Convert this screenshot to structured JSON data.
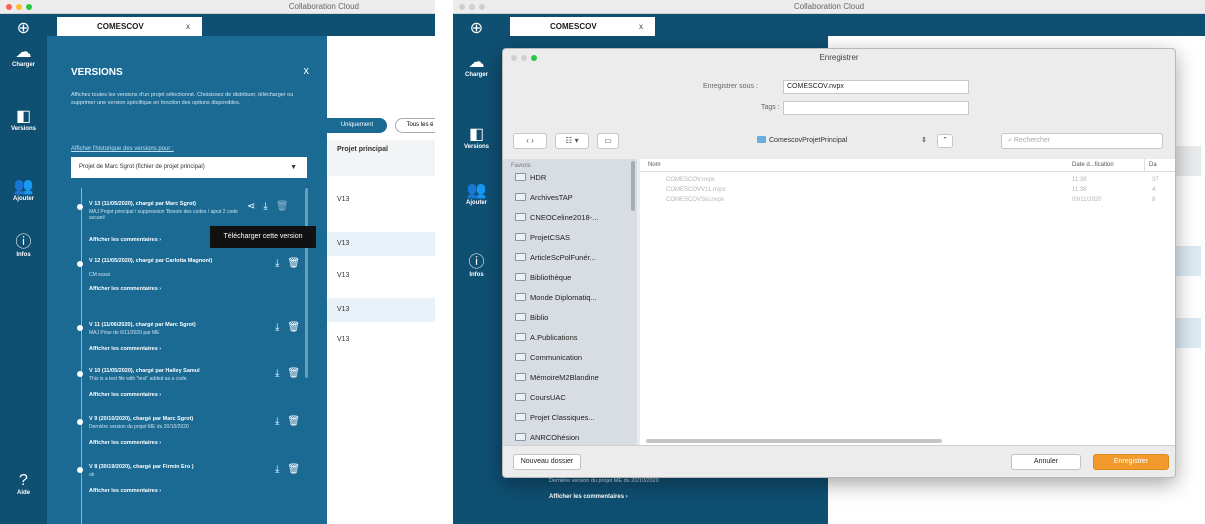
{
  "app": {
    "title": "Collaboration Cloud",
    "tab_label": "COMESCOV",
    "tab_close": "x"
  },
  "nav": {
    "charger": "Charger",
    "versions": "Versions",
    "ajouter": "Ajouter",
    "infos": "Infos",
    "aide": "Aide"
  },
  "versions_panel": {
    "title": "VERSIONS",
    "close": "x",
    "description": "Affichez toutes les versions d'un projet sélectionné. Choisissez de distribuer, télécharger ou supprimer une version spécifique en fonction des options disponibles.",
    "history_link": "Afficher l'historique des versions pour :",
    "select_value": "Projet de Marc Sgrot (fichier de projet principal)",
    "comments_label": "Afficher les commentaires",
    "items": [
      {
        "title": "V 13 (11/05/2020), chargé par Marc Sgrot)",
        "sub": "MAJ Projet principal / suppression 'Besoin des codes / ajout 2 code accueil"
      },
      {
        "title": "V 12 (11/05/2020), chargé par Carlotta Magnoni)",
        "sub": "CM essai"
      },
      {
        "title": "V 11 (11/06/2020), chargé par Marc Sgrot)",
        "sub": "MAJ Prise de 6/11/2020 par ME"
      },
      {
        "title": "V 10 (11/05/2020), chargé par Hailey Samul",
        "sub": "This is a test file with \"test\" added as a code"
      },
      {
        "title": "V 9 (20/10/2020), chargé par Marc Sgrot)",
        "sub": "Dernière version du projet ME du 20/10/2020"
      },
      {
        "title": "V 8 (30/19/2020), chargé par Firmin Ero )",
        "sub": "ok"
      }
    ],
    "tooltip": "Télécharger cette version"
  },
  "main_panel": {
    "filter_active": "Uniquement",
    "filter_all": "Tous les é",
    "column_header": "Projet principal",
    "rows": [
      "V13",
      "V13",
      "V13",
      "V13",
      "V13"
    ]
  },
  "save_dialog": {
    "title": "Enregistrer",
    "save_as_label": "Enregistrer sous :",
    "save_as_value": "COMESCOV.nvpx",
    "tags_label": "Tags :",
    "tags_value": "",
    "location": "ComescovProjetPrincipal",
    "search_placeholder": "Rechercher",
    "sidebar_header": "Favoris",
    "folders": [
      "HDR",
      "ArchivesTAP",
      "CNEOCeline2018-...",
      "ProjetCSAS",
      "ArticleScPolFunér...",
      "Bibliothèque",
      "Monde Diplomatiq...",
      "Biblio",
      "A.Publications",
      "Communication",
      "MémoireM2Blandine",
      "CoursUAC",
      "Projet Classiques...",
      "ANRCOhésion"
    ],
    "list_headers": {
      "name": "Nom",
      "date": "Date d...fication",
      "extra": "Da"
    },
    "files": [
      {
        "name": "COMESCOV.nvpx",
        "date": "11:38",
        "extra": "37"
      },
      {
        "name": "COMESCOVV11.nvpx",
        "date": "11:38",
        "extra": "4"
      },
      {
        "name": "COMESCOVSio.nvpx",
        "date": "09/11/2020",
        "extra": "8"
      }
    ],
    "new_folder": "Nouveau dossier",
    "cancel": "Annuler",
    "save": "Enregistrer"
  },
  "behind_dialog": {
    "desc": "Dernière version du projet ME du 20/10/2020",
    "comments": "Afficher les commentaires"
  },
  "colors": {
    "rail": "#0f4f72",
    "panel": "#1a6a94",
    "accent": "#f29b2c"
  }
}
